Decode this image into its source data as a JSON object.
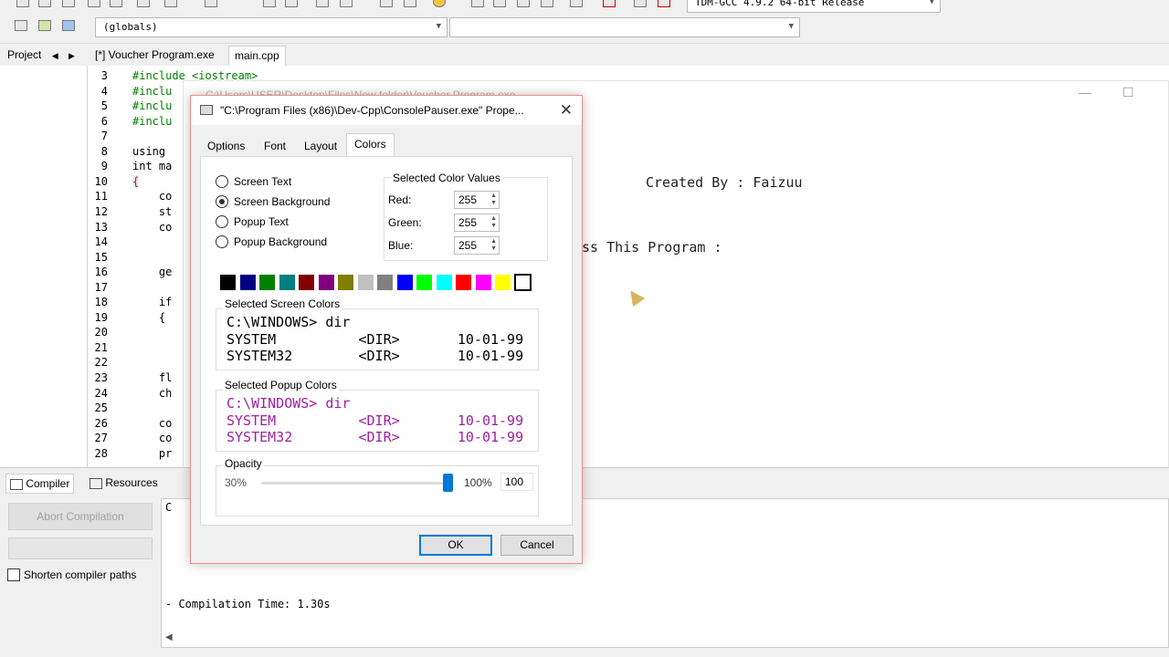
{
  "toolbar": {
    "globals_combo": "(globals)",
    "compiler_combo": "TDM-GCC 4.9.2 64-bit Release"
  },
  "tabs": {
    "project_label": "Project",
    "files": [
      "[*] Voucher Program.exe",
      "main.cpp"
    ]
  },
  "editor": {
    "lines": [
      {
        "n": "3",
        "code": "#include <iostream>"
      },
      {
        "n": "4",
        "code": "#inclu"
      },
      {
        "n": "5",
        "code": "#inclu"
      },
      {
        "n": "6",
        "code": "#inclu"
      },
      {
        "n": "7",
        "code": ""
      },
      {
        "n": "8",
        "code": "using"
      },
      {
        "n": "9",
        "code": "int ma"
      },
      {
        "n": "10",
        "code": "{"
      },
      {
        "n": "11",
        "code": "    co"
      },
      {
        "n": "12",
        "code": "    st"
      },
      {
        "n": "13",
        "code": "    co"
      },
      {
        "n": "14",
        "code": ""
      },
      {
        "n": "15",
        "code": ""
      },
      {
        "n": "16",
        "code": "    ge"
      },
      {
        "n": "17",
        "code": ""
      },
      {
        "n": "18",
        "code": "    if"
      },
      {
        "n": "19",
        "code": "    {"
      },
      {
        "n": "20",
        "code": ""
      },
      {
        "n": "21",
        "code": ""
      },
      {
        "n": "22",
        "code": ""
      },
      {
        "n": "23",
        "code": "    fl"
      },
      {
        "n": "24",
        "code": "    ch"
      },
      {
        "n": "25",
        "code": ""
      },
      {
        "n": "26",
        "code": "    co"
      },
      {
        "n": "27",
        "code": "    co"
      },
      {
        "n": "28",
        "code": "    pr"
      }
    ]
  },
  "console": {
    "title": "C:\\Users\\USER\\Desktop\\Files\\New folder\\Voucher Program.exe",
    "line1": "Created By : Faizuu",
    "line2": "ss This Program :"
  },
  "bottom": {
    "tab_compiler": "Compiler",
    "tab_resources": "Resources",
    "abort_button": "Abort Compilation",
    "shorten_paths": "Shorten compiler paths",
    "log_c": "C",
    "log_compile_time": "- Compilation Time: 1.30s"
  },
  "dialog": {
    "title": "\"C:\\Program Files (x86)\\Dev-Cpp\\ConsolePauser.exe\" Prope...",
    "tabs": [
      "Options",
      "Font",
      "Layout",
      "Colors"
    ],
    "radios": [
      "Screen Text",
      "Screen Background",
      "Popup Text",
      "Popup Background"
    ],
    "selected_radio": 1,
    "color_values_label": "Selected Color Values",
    "red_label": "Red:",
    "green_label": "Green:",
    "blue_label": "Blue:",
    "red": "255",
    "green": "255",
    "blue": "255",
    "palette": [
      "#000000",
      "#000080",
      "#008000",
      "#008080",
      "#800000",
      "#800080",
      "#808000",
      "#c0c0c0",
      "#808080",
      "#0000ff",
      "#00ff00",
      "#00ffff",
      "#ff0000",
      "#ff00ff",
      "#ffff00",
      "#ffffff"
    ],
    "selected_palette_index": 15,
    "screen_colors_label": "Selected Screen Colors",
    "screen_preview": [
      "C:\\WINDOWS> dir",
      "SYSTEM          <DIR>       10-01-99",
      "SYSTEM32        <DIR>       10-01-99"
    ],
    "popup_colors_label": "Selected Popup Colors",
    "popup_preview": [
      "C:\\WINDOWS> dir",
      "SYSTEM          <DIR>       10-01-99",
      "SYSTEM32        <DIR>       10-01-99"
    ],
    "popup_text_color": "#a020a0",
    "opacity_label": "Opacity",
    "opacity_min": "30%",
    "opacity_max": "100%",
    "opacity_value": "100",
    "opacity_fraction": 1.0,
    "ok": "OK",
    "cancel": "Cancel"
  }
}
